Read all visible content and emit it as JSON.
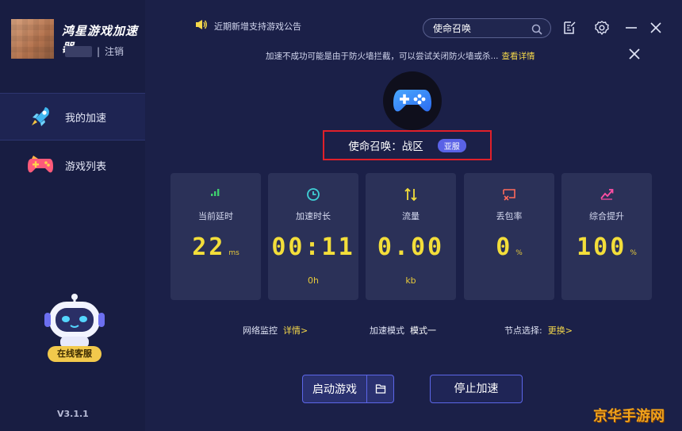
{
  "app": {
    "logo_text": "鸿星游戏加速器",
    "logout_label": "注销",
    "user_separator": "|",
    "version": "V3.1.1"
  },
  "sidebar": {
    "items": [
      {
        "label": "我的加速",
        "icon": "rocket-icon",
        "active": true
      },
      {
        "label": "游戏列表",
        "icon": "gamepad-icon",
        "active": false
      }
    ],
    "online_service_label": "在线客服"
  },
  "topbar": {
    "notice": "近期新增支持游戏公告",
    "search": {
      "value": "使命召唤",
      "placeholder": ""
    },
    "tip_text": "加速不成功可能是由于防火墙拦截，可以尝试关闭防火墙或杀...",
    "tip_link": "查看详情"
  },
  "game": {
    "name": "使命召唤：战区",
    "region_badge": "亚服"
  },
  "stats": [
    {
      "label": "当前延时",
      "value": "22",
      "unit": "ms",
      "sub": "",
      "icon": "signal-icon",
      "color": "#3ecf6e"
    },
    {
      "label": "加速时长",
      "value": "00:11",
      "unit": "",
      "sub": "0h",
      "icon": "clock-icon",
      "color": "#3fd0d6"
    },
    {
      "label": "流量",
      "value": "0.00",
      "unit": "",
      "sub": "kb",
      "icon": "updown-icon",
      "color": "#f3de3a"
    },
    {
      "label": "丢包率",
      "value": "0",
      "unit": "%",
      "sub": "",
      "icon": "packet-loss-icon",
      "color": "#ff6a5a"
    },
    {
      "label": "综合提升",
      "value": "100",
      "unit": "%",
      "sub": "",
      "icon": "trend-up-icon",
      "color": "#ff4fa3"
    }
  ],
  "info": {
    "monitor_label": "网络监控",
    "monitor_link": "详情>",
    "mode_label": "加速模式",
    "mode_value": "模式一",
    "node_label": "节点选择:",
    "node_link": "更换>"
  },
  "buttons": {
    "start_game": "启动游戏",
    "stop_boost": "停止加速"
  },
  "watermark": "京华手游网",
  "colors": {
    "accent": "#5a62e6",
    "highlight": "#f3de3a",
    "background": "#1b2048",
    "card": "#2b3158"
  }
}
